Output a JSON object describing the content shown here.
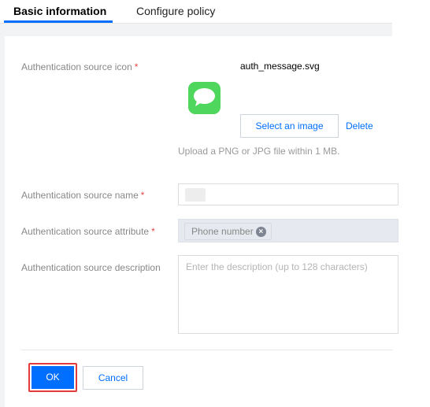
{
  "tabs": [
    {
      "label": "Basic information",
      "active": true
    },
    {
      "label": "Configure policy",
      "active": false
    }
  ],
  "form": {
    "icon_label": "Authentication source icon",
    "icon_filename": "auth_message.svg",
    "icon_name": "message-bubble-icon",
    "select_image_label": "Select an image",
    "delete_label": "Delete",
    "upload_hint": "Upload a PNG or JPG file within 1 MB.",
    "name_label": "Authentication source name",
    "name_value": "",
    "attribute_label": "Authentication source attribute",
    "attribute_tag": "Phone number",
    "description_label": "Authentication source description",
    "description_placeholder": "Enter the description (up to 128 characters)",
    "required_mark": "*"
  },
  "actions": {
    "ok_label": "OK",
    "cancel_label": "Cancel"
  },
  "colors": {
    "accent": "#006eff",
    "icon_green": "#4fd65c",
    "required": "#e54545",
    "highlight_border": "#e13b3b"
  }
}
